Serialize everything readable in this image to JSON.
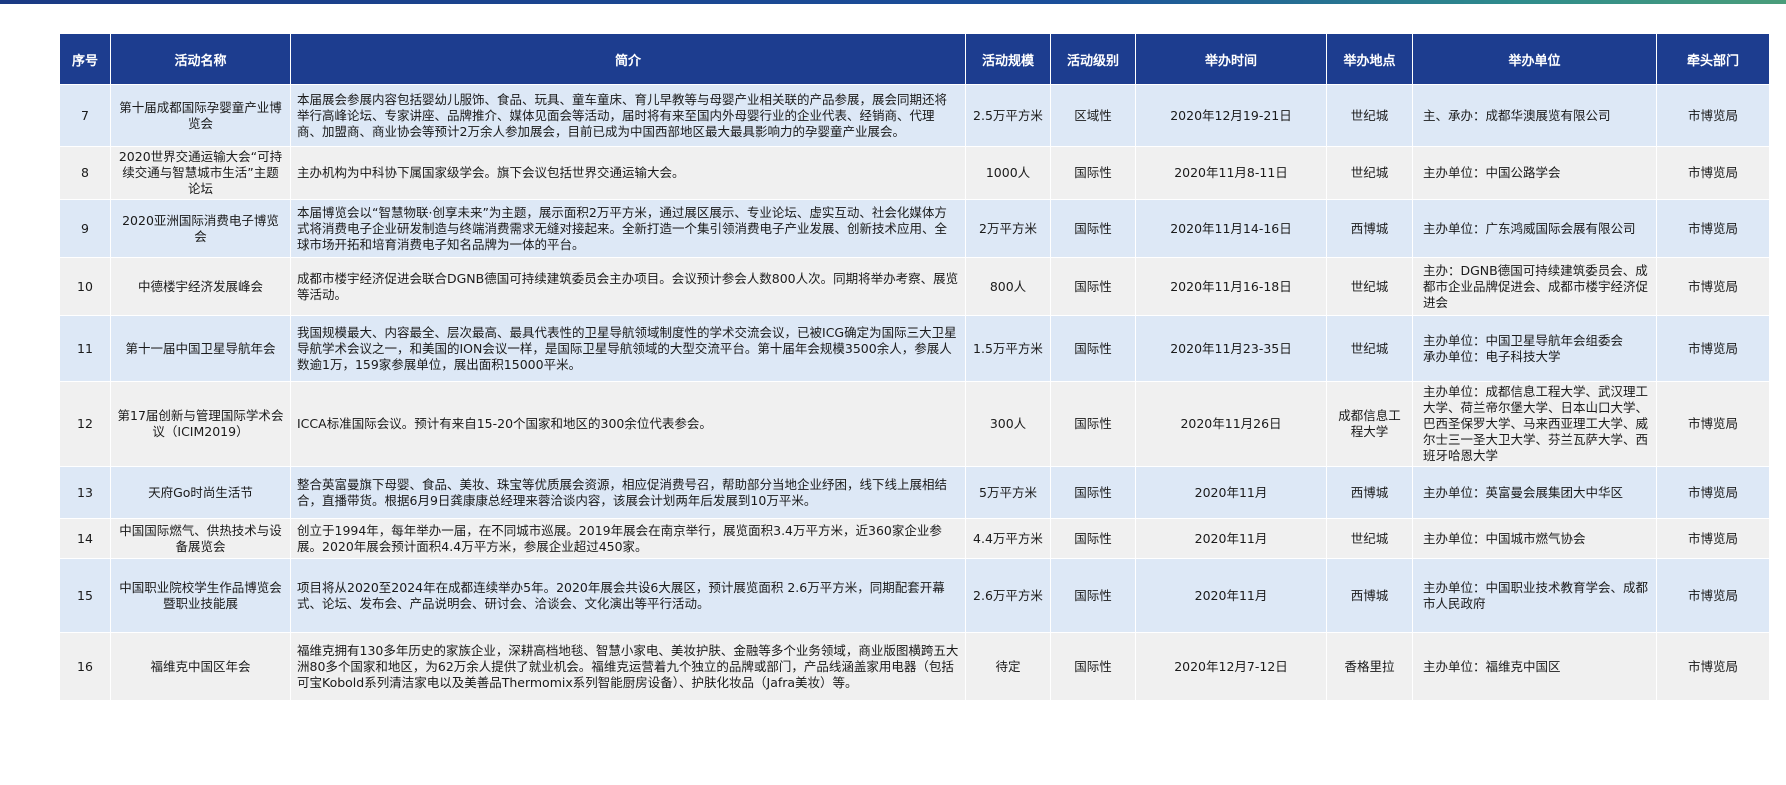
{
  "headers": [
    "序号",
    "活动名称",
    "简介",
    "活动规模",
    "活动级别",
    "举办时间",
    "举办地点",
    "举办单位",
    "牵头部门"
  ],
  "rows": [
    {
      "no": "7",
      "name": "第十届成都国际孕婴童产业博览会",
      "intro": "本届展会参展内容包括婴幼儿服饰、食品、玩具、童车童床、育儿早教等与母婴产业相关联的产品参展，展会同期还将举行高峰论坛、专家讲座、品牌推介、媒体见面会等活动，届时将有来至国内外母婴行业的企业代表、经销商、代理商、加盟商、商业协会等预计2万余人参加展会，目前已成为中国西部地区最大最具影响力的孕婴童产业展会。",
      "scale": "2.5万平方米",
      "level": "区域性",
      "time": "2020年12月19-21日",
      "place": "世纪城",
      "org": "主、承办：成都华澳展览有限公司",
      "dept": "市博览局"
    },
    {
      "no": "8",
      "name": "2020世界交通运输大会“可持续交通与智慧城市生活”主题论坛",
      "intro": "主办机构为中科协下属国家级学会。旗下会议包括世界交通运输大会。",
      "scale": "1000人",
      "level": "国际性",
      "time": "2020年11月8-11日",
      "place": "世纪城",
      "org": "主办单位：中国公路学会",
      "dept": "市博览局"
    },
    {
      "no": "9",
      "name": "2020亚洲国际消费电子博览会",
      "intro": "本届博览会以“智慧物联·创享未来”为主题，展示面积2万平方米，通过展区展示、专业论坛、虚实互动、社会化媒体方式将消费电子企业研发制造与终端消费需求无缝对接起来。全新打造一个集引领消费电子产业发展、创新技术应用、全球市场开拓和培育消费电子知名品牌为一体的平台。",
      "scale": "2万平方米",
      "level": "国际性",
      "time": "2020年11月14-16日",
      "place": "西博城",
      "org": "主办单位：广东鸿威国际会展有限公司",
      "dept": "市博览局"
    },
    {
      "no": "10",
      "name": "中德楼宇经济发展峰会",
      "intro": "成都市楼宇经济促进会联合DGNB德国可持续建筑委员会主办项目。会议预计参会人数800人次。同期将举办考察、展览等活动。",
      "scale": "800人",
      "level": "国际性",
      "time": "2020年11月16-18日",
      "place": "世纪城",
      "org": "主办：DGNB德国可持续建筑委员会、成都市企业品牌促进会、成都市楼宇经济促进会",
      "dept": "市博览局"
    },
    {
      "no": "11",
      "name": "第十一届中国卫星导航年会",
      "intro": "我国规模最大、内容最全、层次最高、最具代表性的卫星导航领域制度性的学术交流会议，已被ICG确定为国际三大卫星导航学术会议之一，和美国的ION会议一样，是国际卫星导航领域的大型交流平台。第十届年会规模3500余人，参展人数逾1万，159家参展单位，展出面积15000平米。",
      "scale": "1.5万平方米",
      "level": "国际性",
      "time": "2020年11月23-35日",
      "place": "世纪城",
      "org": "主办单位：中国卫星导航年会组委会\n承办单位：电子科技大学",
      "dept": "市博览局"
    },
    {
      "no": "12",
      "name": "第17届创新与管理国际学术会议（ICIM2019）",
      "intro": "ICCA标准国际会议。预计有来自15-20个国家和地区的300余位代表参会。",
      "scale": "300人",
      "level": "国际性",
      "time": "2020年11月26日",
      "place": "成都信息工程大学",
      "org": "主办单位：成都信息工程大学、武汉理工大学、荷兰帝尔堡大学、日本山口大学、巴西圣保罗大学、马来西亚理工大学、威尔士三一圣大卫大学、芬兰瓦萨大学、西班牙哈恩大学",
      "dept": "市博览局"
    },
    {
      "no": "13",
      "name": "天府Go时尚生活节",
      "intro": "整合英富曼旗下母婴、食品、美妆、珠宝等优质展会资源，相应促消费号召，帮助部分当地企业纾困，线下线上展相结合，直播带货。根据6月9日龚康康总经理来蓉洽谈内容，该展会计划两年后发展到10万平米。",
      "scale": "5万平方米",
      "level": "国际性",
      "time": "2020年11月",
      "place": "西博城",
      "org": "主办单位：英富曼会展集团大中华区",
      "dept": "市博览局"
    },
    {
      "no": "14",
      "name": "中国国际燃气、供热技术与设备展览会",
      "intro": "创立于1994年，每年举办一届，在不同城市巡展。2019年展会在南京举行，展览面积3.4万平方米，近360家企业参展。2020年展会预计面积4.4万平方米，参展企业超过450家。",
      "scale": "4.4万平方米",
      "level": "国际性",
      "time": "2020年11月",
      "place": "世纪城",
      "org": "主办单位：中国城市燃气协会",
      "dept": "市博览局"
    },
    {
      "no": "15",
      "name": "中国职业院校学生作品博览会暨职业技能展",
      "intro": "项目将从2020至2024年在成都连续举办5年。2020年展会共设6大展区，预计展览面积 2.6万平方米，同期配套开幕式、论坛、发布会、产品说明会、研讨会、洽谈会、文化演出等平行活动。",
      "scale": "2.6万平方米",
      "level": "国际性",
      "time": "2020年11月",
      "place": "西博城",
      "org": "主办单位：中国职业技术教育学会、成都市人民政府",
      "dept": "市博览局"
    },
    {
      "no": "16",
      "name": "福维克中国区年会",
      "intro": "福维克拥有130多年历史的家族企业，深耕高档地毯、智慧小家电、美妆护肤、金融等多个业务领域，商业版图横跨五大洲80多个国家和地区，为62万余人提供了就业机会。福维克运营着九个独立的品牌或部门，产品线涵盖家用电器（包括可宝Kobold系列清洁家电以及美善品Thermomix系列智能厨房设备）、护肤化妆品（Jafra美妆）等。",
      "scale": "待定",
      "level": "国际性",
      "time": "2020年12月7-12日",
      "place": "香格里拉",
      "org": "主办单位：福维克中国区",
      "dept": "市博览局"
    }
  ]
}
